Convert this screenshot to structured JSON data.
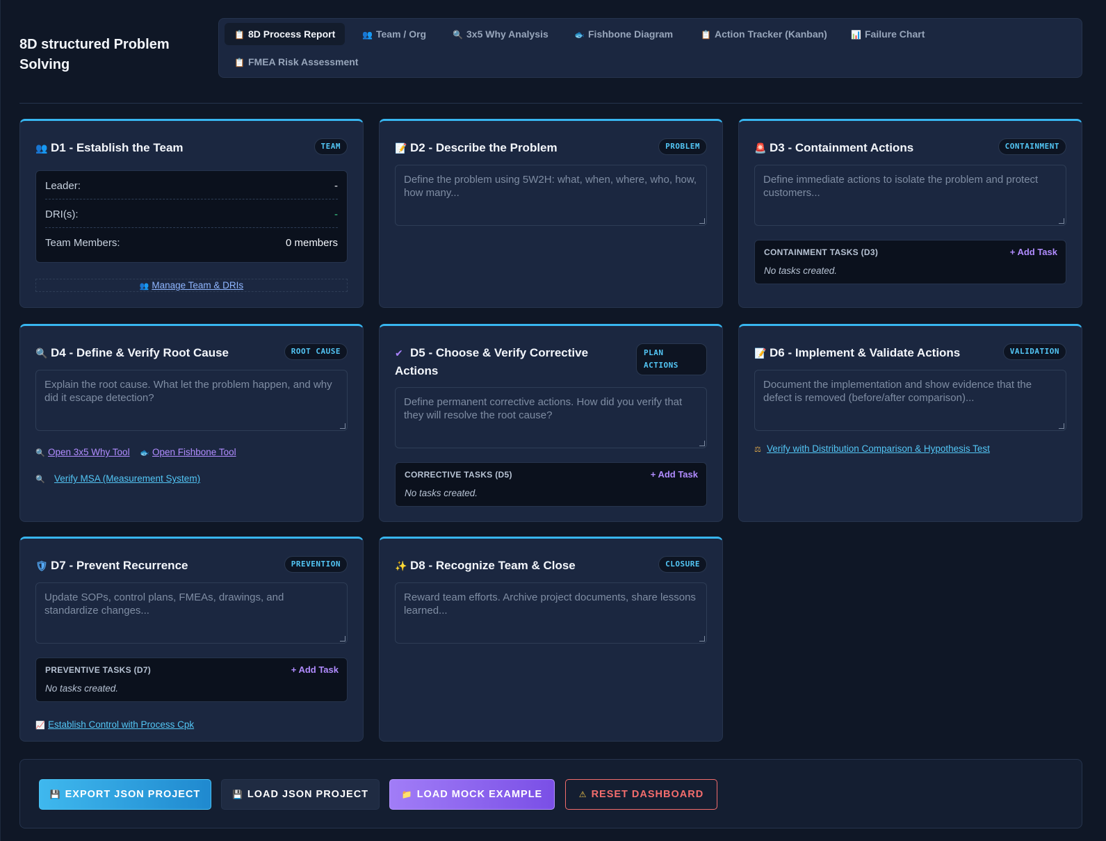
{
  "app": {
    "title": "8D structured Problem Solving"
  },
  "tabs": [
    {
      "label": "8D Process Report",
      "icon": "📋",
      "icon_name": "clipboard-icon"
    },
    {
      "label": "Team / Org",
      "icon": "👥",
      "icon_name": "people-icon"
    },
    {
      "label": "3x5 Why Analysis",
      "icon": "🔍",
      "icon_name": "magnifier-icon"
    },
    {
      "label": "Fishbone Diagram",
      "icon": "🐟",
      "icon_name": "fish-icon"
    },
    {
      "label": "Action Tracker (Kanban)",
      "icon": "📋",
      "icon_name": "clipboard-icon"
    },
    {
      "label": "Failure Chart",
      "icon": "📊",
      "icon_name": "bar-chart-icon"
    },
    {
      "label": "FMEA Risk Assessment",
      "icon": "📋",
      "icon_name": "clipboard-icon"
    }
  ],
  "d1": {
    "icon": "👥",
    "title": "D1 - Establish the Team",
    "badge": "TEAM",
    "leader_label": "Leader:",
    "leader_value": "-",
    "dri_label": "DRI(s):",
    "dri_value": "-",
    "members_label": "Team Members:",
    "members_value": "0 members",
    "manage_icon": "👥",
    "manage_label": "Manage Team & DRIs"
  },
  "d2": {
    "icon": "📝",
    "title": "D2 - Describe the Problem",
    "badge": "PROBLEM",
    "placeholder": "Define the problem using 5W2H: what, when, where, who, how, how many..."
  },
  "d3": {
    "icon": "🚨",
    "title": "D3 - Containment Actions",
    "badge": "CONTAINMENT",
    "placeholder": "Define immediate actions to isolate the problem and protect customers...",
    "tasks_header": "CONTAINMENT TASKS (D3)",
    "add_task": "+ Add Task",
    "empty": "No tasks created."
  },
  "d4": {
    "icon": "🔍",
    "title": "D4 - Define & Verify Root Cause",
    "badge": "ROOT CAUSE",
    "placeholder": "Explain the root cause. What let the problem happen, and why did it escape detection?",
    "link_why_icon": "🔍",
    "link_why": "Open 3x5 Why Tool",
    "link_fish_icon": "🐟",
    "link_fish": "Open Fishbone Tool",
    "link_msa_icon": "🔍",
    "link_msa": "Verify MSA (Measurement System)"
  },
  "d5": {
    "icon": "✔",
    "title_line1": "D5 - Choose & Verify Corrective",
    "title_line2": "Actions",
    "badge_line1": "PLAN",
    "badge_line2": "ACTIONS",
    "placeholder": "Define permanent corrective actions. How did you verify that they will resolve the root cause?",
    "tasks_header": "CORRECTIVE TASKS (D5)",
    "add_task": "+ Add Task",
    "empty": "No tasks created."
  },
  "d6": {
    "icon": "📝",
    "title": "D6 - Implement & Validate Actions",
    "badge": "VALIDATION",
    "placeholder": "Document the implementation and show evidence that the defect is removed (before/after comparison)...",
    "link_icon": "⚖",
    "link": "Verify with Distribution Comparison & Hypothesis Test"
  },
  "d7": {
    "icon": "🛡",
    "title": "D7 - Prevent Recurrence",
    "badge": "PREVENTION",
    "placeholder": "Update SOPs, control plans, FMEAs, drawings, and standardize changes...",
    "tasks_header": "PREVENTIVE TASKS (D7)",
    "add_task": "+ Add Task",
    "empty": "No tasks created.",
    "link_icon": "📈",
    "link": "Establish Control with Process Cpk"
  },
  "d8": {
    "icon": "✨",
    "title": "D8 - Recognize Team & Close",
    "badge": "CLOSURE",
    "placeholder": "Reward team efforts. Archive project documents, share lessons learned..."
  },
  "footer": {
    "export_icon": "💾",
    "export": "EXPORT JSON PROJECT",
    "load_icon": "💾",
    "load": "LOAD JSON PROJECT",
    "mock_icon": "📁",
    "mock": "LOAD MOCK EXAMPLE",
    "reset_icon": "⚠",
    "reset": "RESET DASHBOARD"
  },
  "colors": {
    "background": "#0f1726",
    "card": "#1b2740",
    "accent": "#38b6f0",
    "purple": "#b18cff",
    "danger": "#f36d6d",
    "success": "#3ad08a"
  }
}
